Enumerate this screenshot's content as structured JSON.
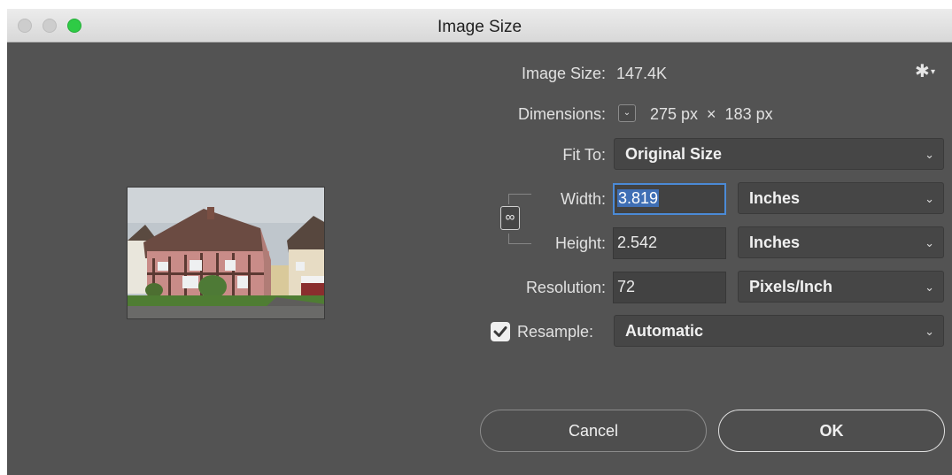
{
  "window": {
    "title": "Image Size"
  },
  "info": {
    "image_size_label": "Image Size:",
    "image_size_value": "147.4K",
    "dimensions_label": "Dimensions:",
    "dimensions_value": "275 px  ×  183 px"
  },
  "fit_to": {
    "label": "Fit To:",
    "value": "Original Size"
  },
  "width": {
    "label": "Width:",
    "value": "3.819",
    "unit": "Inches"
  },
  "height": {
    "label": "Height:",
    "value": "2.542",
    "unit": "Inches"
  },
  "resolution": {
    "label": "Resolution:",
    "value": "72",
    "unit": "Pixels/Inch"
  },
  "resample": {
    "label": "Resample:",
    "checked": true,
    "value": "Automatic"
  },
  "buttons": {
    "cancel": "Cancel",
    "ok": "OK"
  },
  "icons": {
    "settings": "gear-icon",
    "dimensions_menu": "chevron-down-icon",
    "constrain": "link-icon",
    "check": "checkmark-icon"
  },
  "colors": {
    "dialog_bg": "#535353",
    "field_bg": "#424242",
    "focus_ring": "#4b8ad6",
    "maximize_green": "#2ecb45"
  }
}
